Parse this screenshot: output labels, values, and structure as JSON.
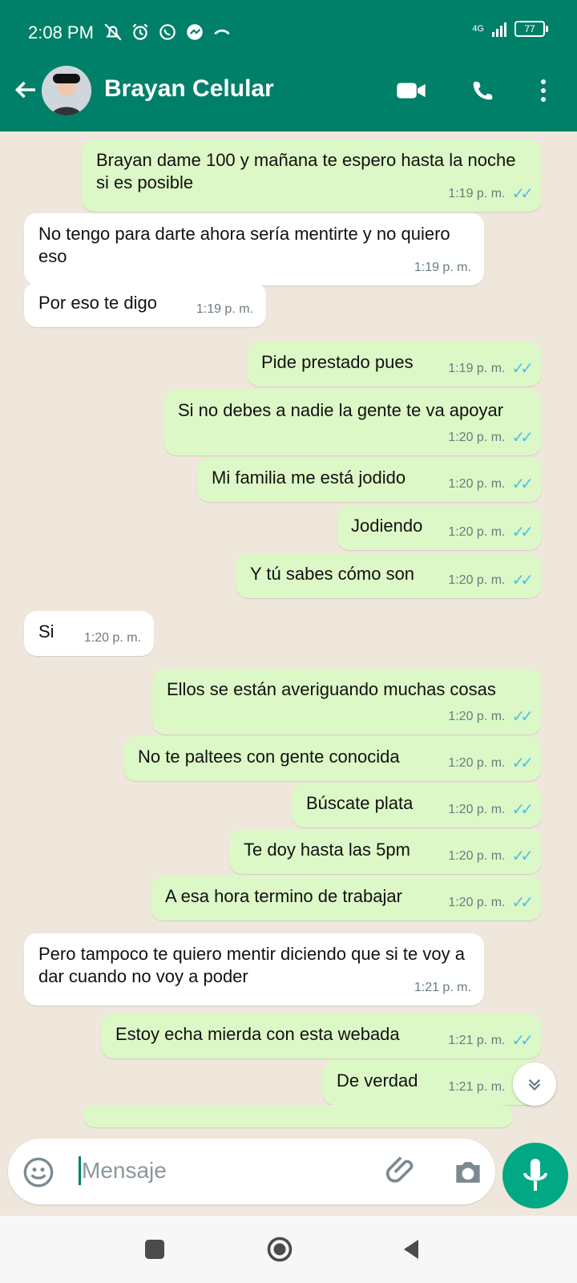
{
  "status_bar": {
    "time": "2:08 PM",
    "network": "4G",
    "battery": "77",
    "icons": [
      "mute-icon",
      "alarm-icon",
      "whatsapp-icon",
      "messenger-icon",
      "missed-call-icon"
    ]
  },
  "header": {
    "back_icon": "arrow-left-icon",
    "contact_name": "Brayan Celular",
    "actions": [
      "video-call-icon",
      "phone-icon",
      "more-icon"
    ]
  },
  "messages": [
    {
      "dir": "out",
      "text": "Brayan dame 100 y mañana te espero hasta la noche si es posible",
      "time": "1:19 p. m.",
      "read": true
    },
    {
      "dir": "in",
      "text": "No tengo para darte ahora sería mentirte y no quiero eso",
      "time": "1:19 p. m."
    },
    {
      "dir": "in",
      "text": "Por eso te digo",
      "time": "1:19 p. m."
    },
    {
      "dir": "out",
      "text": "Pide prestado pues",
      "time": "1:19 p. m.",
      "read": true
    },
    {
      "dir": "out",
      "text": "Si no debes a nadie la gente te va apoyar",
      "time": "1:20 p. m.",
      "read": true
    },
    {
      "dir": "out",
      "text": "Mi familia me está jodido",
      "time": "1:20 p. m.",
      "read": true
    },
    {
      "dir": "out",
      "text": "Jodiendo",
      "time": "1:20 p. m.",
      "read": true
    },
    {
      "dir": "out",
      "text": "Y tú sabes cómo son",
      "time": "1:20 p. m.",
      "read": true
    },
    {
      "dir": "in",
      "text": "Si",
      "time": "1:20 p. m."
    },
    {
      "dir": "out",
      "text": "Ellos se están averiguando muchas cosas",
      "time": "1:20 p. m.",
      "read": true
    },
    {
      "dir": "out",
      "text": "No te paltees con gente conocida",
      "time": "1:20 p. m.",
      "read": true
    },
    {
      "dir": "out",
      "text": "Búscate plata",
      "time": "1:20 p. m.",
      "read": true
    },
    {
      "dir": "out",
      "text": "Te doy hasta las 5pm",
      "time": "1:20 p. m.",
      "read": true
    },
    {
      "dir": "out",
      "text": "A esa hora termino de trabajar",
      "time": "1:20 p. m.",
      "read": true
    },
    {
      "dir": "in",
      "text": "Pero tampoco te quiero mentir diciendo que si te voy a dar cuando no voy a poder",
      "time": "1:21 p. m."
    },
    {
      "dir": "out",
      "text": "Estoy echa mierda con esta webada",
      "time": "1:21 p. m.",
      "read": true
    },
    {
      "dir": "out",
      "text": "De verdad",
      "time": "1:21 p. m.",
      "read": true
    }
  ],
  "composer": {
    "placeholder": "Mensaje",
    "icons": [
      "emoji-icon",
      "attach-icon",
      "camera-icon",
      "mic-icon"
    ]
  },
  "colors": {
    "header": "#008069",
    "outgoing": "#dcf8c6",
    "incoming": "#ffffff",
    "accent": "#00a884",
    "read_ticks": "#53bdeb"
  },
  "navigation": [
    "recent-apps-icon",
    "home-icon",
    "back-icon"
  ]
}
